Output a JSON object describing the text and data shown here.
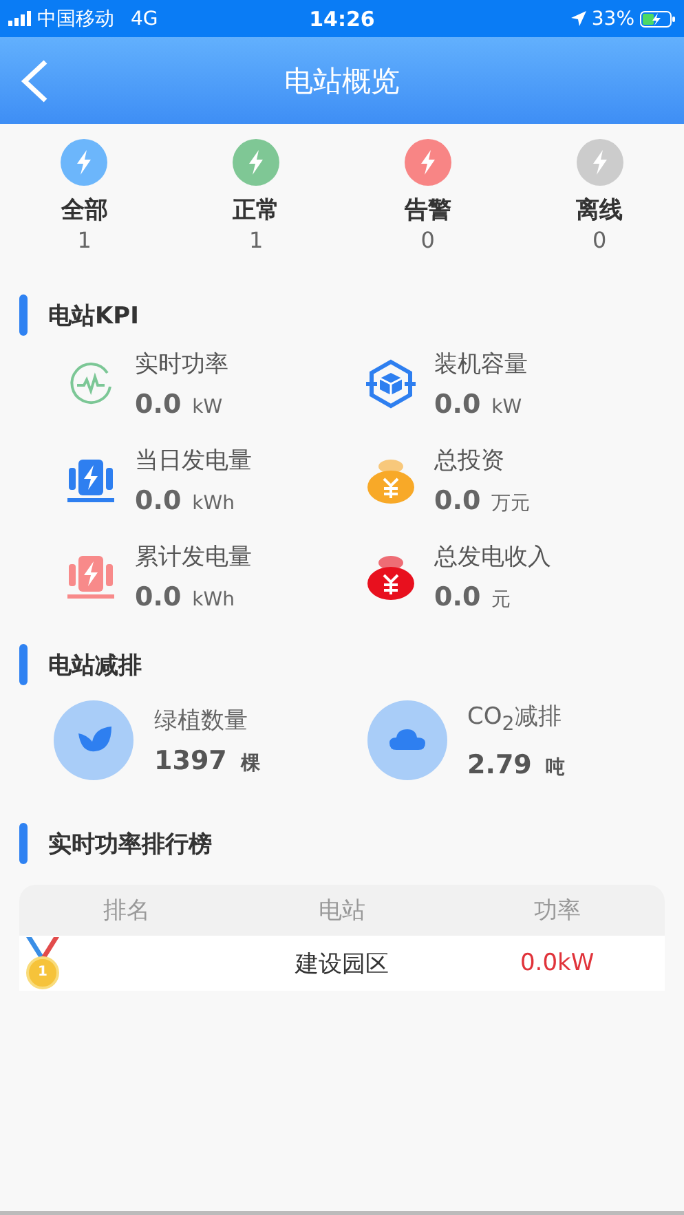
{
  "status_bar": {
    "carrier": "中国移动",
    "network": "4G",
    "time": "14:26",
    "battery": "33%"
  },
  "header": {
    "title": "电站概览"
  },
  "summary": [
    {
      "label": "全部",
      "count": "1",
      "color": "#6cb6fb"
    },
    {
      "label": "正常",
      "count": "1",
      "color": "#7fc795"
    },
    {
      "label": "告警",
      "count": "0",
      "color": "#f88585"
    },
    {
      "label": "离线",
      "count": "0",
      "color": "#cccccc"
    }
  ],
  "kpi": {
    "title": "电站KPI",
    "items": [
      {
        "label": "实时功率",
        "value": "0.0",
        "unit": "kW",
        "kind": "pulse",
        "color": "#7cc796"
      },
      {
        "label": "装机容量",
        "value": "0.0",
        "unit": "kW",
        "kind": "cube",
        "color": "#2e7ff0"
      },
      {
        "label": "当日发电量",
        "value": "0.0",
        "unit": "kWh",
        "kind": "generator",
        "color": "#2e7ff0"
      },
      {
        "label": "总投资",
        "value": "0.0",
        "unit": "万元",
        "kind": "moneybag",
        "color": "#f8a928"
      },
      {
        "label": "累计发电量",
        "value": "0.0",
        "unit": "kWh",
        "kind": "generator",
        "color": "#f88a8a"
      },
      {
        "label": "总发电收入",
        "value": "0.0",
        "unit": "元",
        "kind": "moneybag",
        "color": "#e8101e"
      }
    ]
  },
  "emission": {
    "title": "电站减排",
    "items": [
      {
        "label": "绿植数量",
        "value": "1397",
        "unit": "棵",
        "kind": "leaf"
      },
      {
        "label": "CO$_{2}$减排",
        "value": "2.79",
        "unit": "吨",
        "kind": "cloud"
      }
    ]
  },
  "ranking": {
    "title": "实时功率排行榜",
    "columns": [
      "排名",
      "电站",
      "功率"
    ],
    "rows": [
      {
        "rank": "1",
        "station": "建设园区",
        "power": "0.0kW"
      }
    ]
  }
}
